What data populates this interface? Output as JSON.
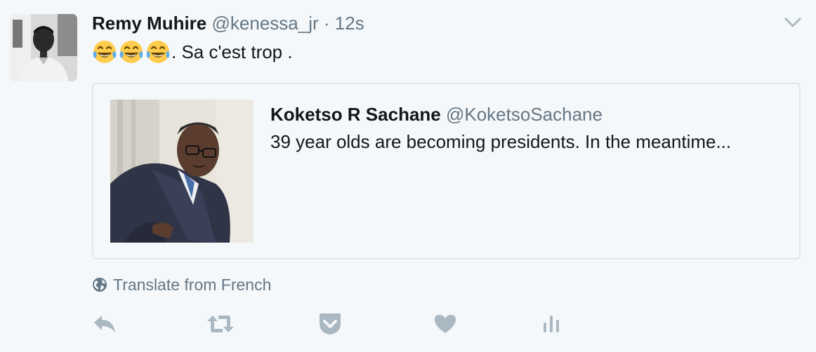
{
  "tweet": {
    "author_name": "Remy Muhire",
    "author_handle": "@kenessa_jr",
    "separator": "·",
    "timestamp": "12s",
    "emojis": [
      "face-with-tears-of-joy",
      "face-with-tears-of-joy",
      "face-with-tears-of-joy"
    ],
    "text": ". Sa c'est trop ."
  },
  "quoted_tweet": {
    "author_name": "Koketso R Sachane",
    "author_handle": "@KoketsoSachane",
    "text": "39 year olds are becoming presidents. In the meantime..."
  },
  "translate": {
    "label": "Translate from French",
    "icon": "globe-icon"
  },
  "actions": {
    "icons": [
      "reply-icon",
      "retweet-icon",
      "pocket-icon",
      "like-icon",
      "analytics-icon"
    ],
    "icon_color": "#aab8c2"
  },
  "colors": {
    "background": "#f5f8fa",
    "text_primary": "#14171a",
    "text_secondary": "#657786",
    "border": "#dfe6eb"
  }
}
